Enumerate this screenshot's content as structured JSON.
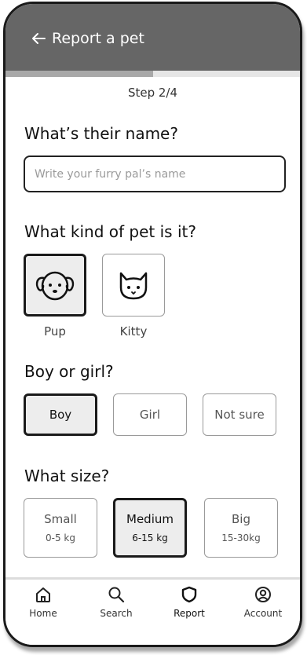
{
  "header": {
    "title": "Report a pet"
  },
  "progress": {
    "fraction": 0.5
  },
  "step": {
    "label": "Step 2/4"
  },
  "name_question": "What’s their name?",
  "name_input": {
    "value": "",
    "placeholder": "Write your furry pal’s name"
  },
  "kind_question": "What kind of pet is it?",
  "pets": [
    {
      "label": "Pup",
      "icon": "dog-icon",
      "selected": true
    },
    {
      "label": "Kitty",
      "icon": "cat-icon",
      "selected": false
    }
  ],
  "gender_question": "Boy or girl?",
  "genders": [
    {
      "label": "Boy",
      "selected": true
    },
    {
      "label": "Girl",
      "selected": false
    },
    {
      "label": "Not sure",
      "selected": false
    }
  ],
  "size_question": "What size?",
  "sizes": [
    {
      "label": "Small",
      "range": "0-5 kg",
      "selected": false
    },
    {
      "label": "Medium",
      "range": "6-15 kg",
      "selected": true
    },
    {
      "label": "Big",
      "range": "15-30kg",
      "selected": false
    }
  ],
  "nav": [
    {
      "label": "Home",
      "icon": "home-icon",
      "active": false
    },
    {
      "label": "Search",
      "icon": "search-icon",
      "active": false
    },
    {
      "label": "Report",
      "icon": "shield-icon",
      "active": true
    },
    {
      "label": "Account",
      "icon": "account-icon",
      "active": false
    }
  ],
  "colors": {
    "header_bg": "#666666",
    "progress_fill": "#a8a8a8",
    "progress_track": "#e6e6e6",
    "selected_bg": "#ededed",
    "border_dark": "#1a1a1a",
    "border_light": "#9a9a9a"
  }
}
